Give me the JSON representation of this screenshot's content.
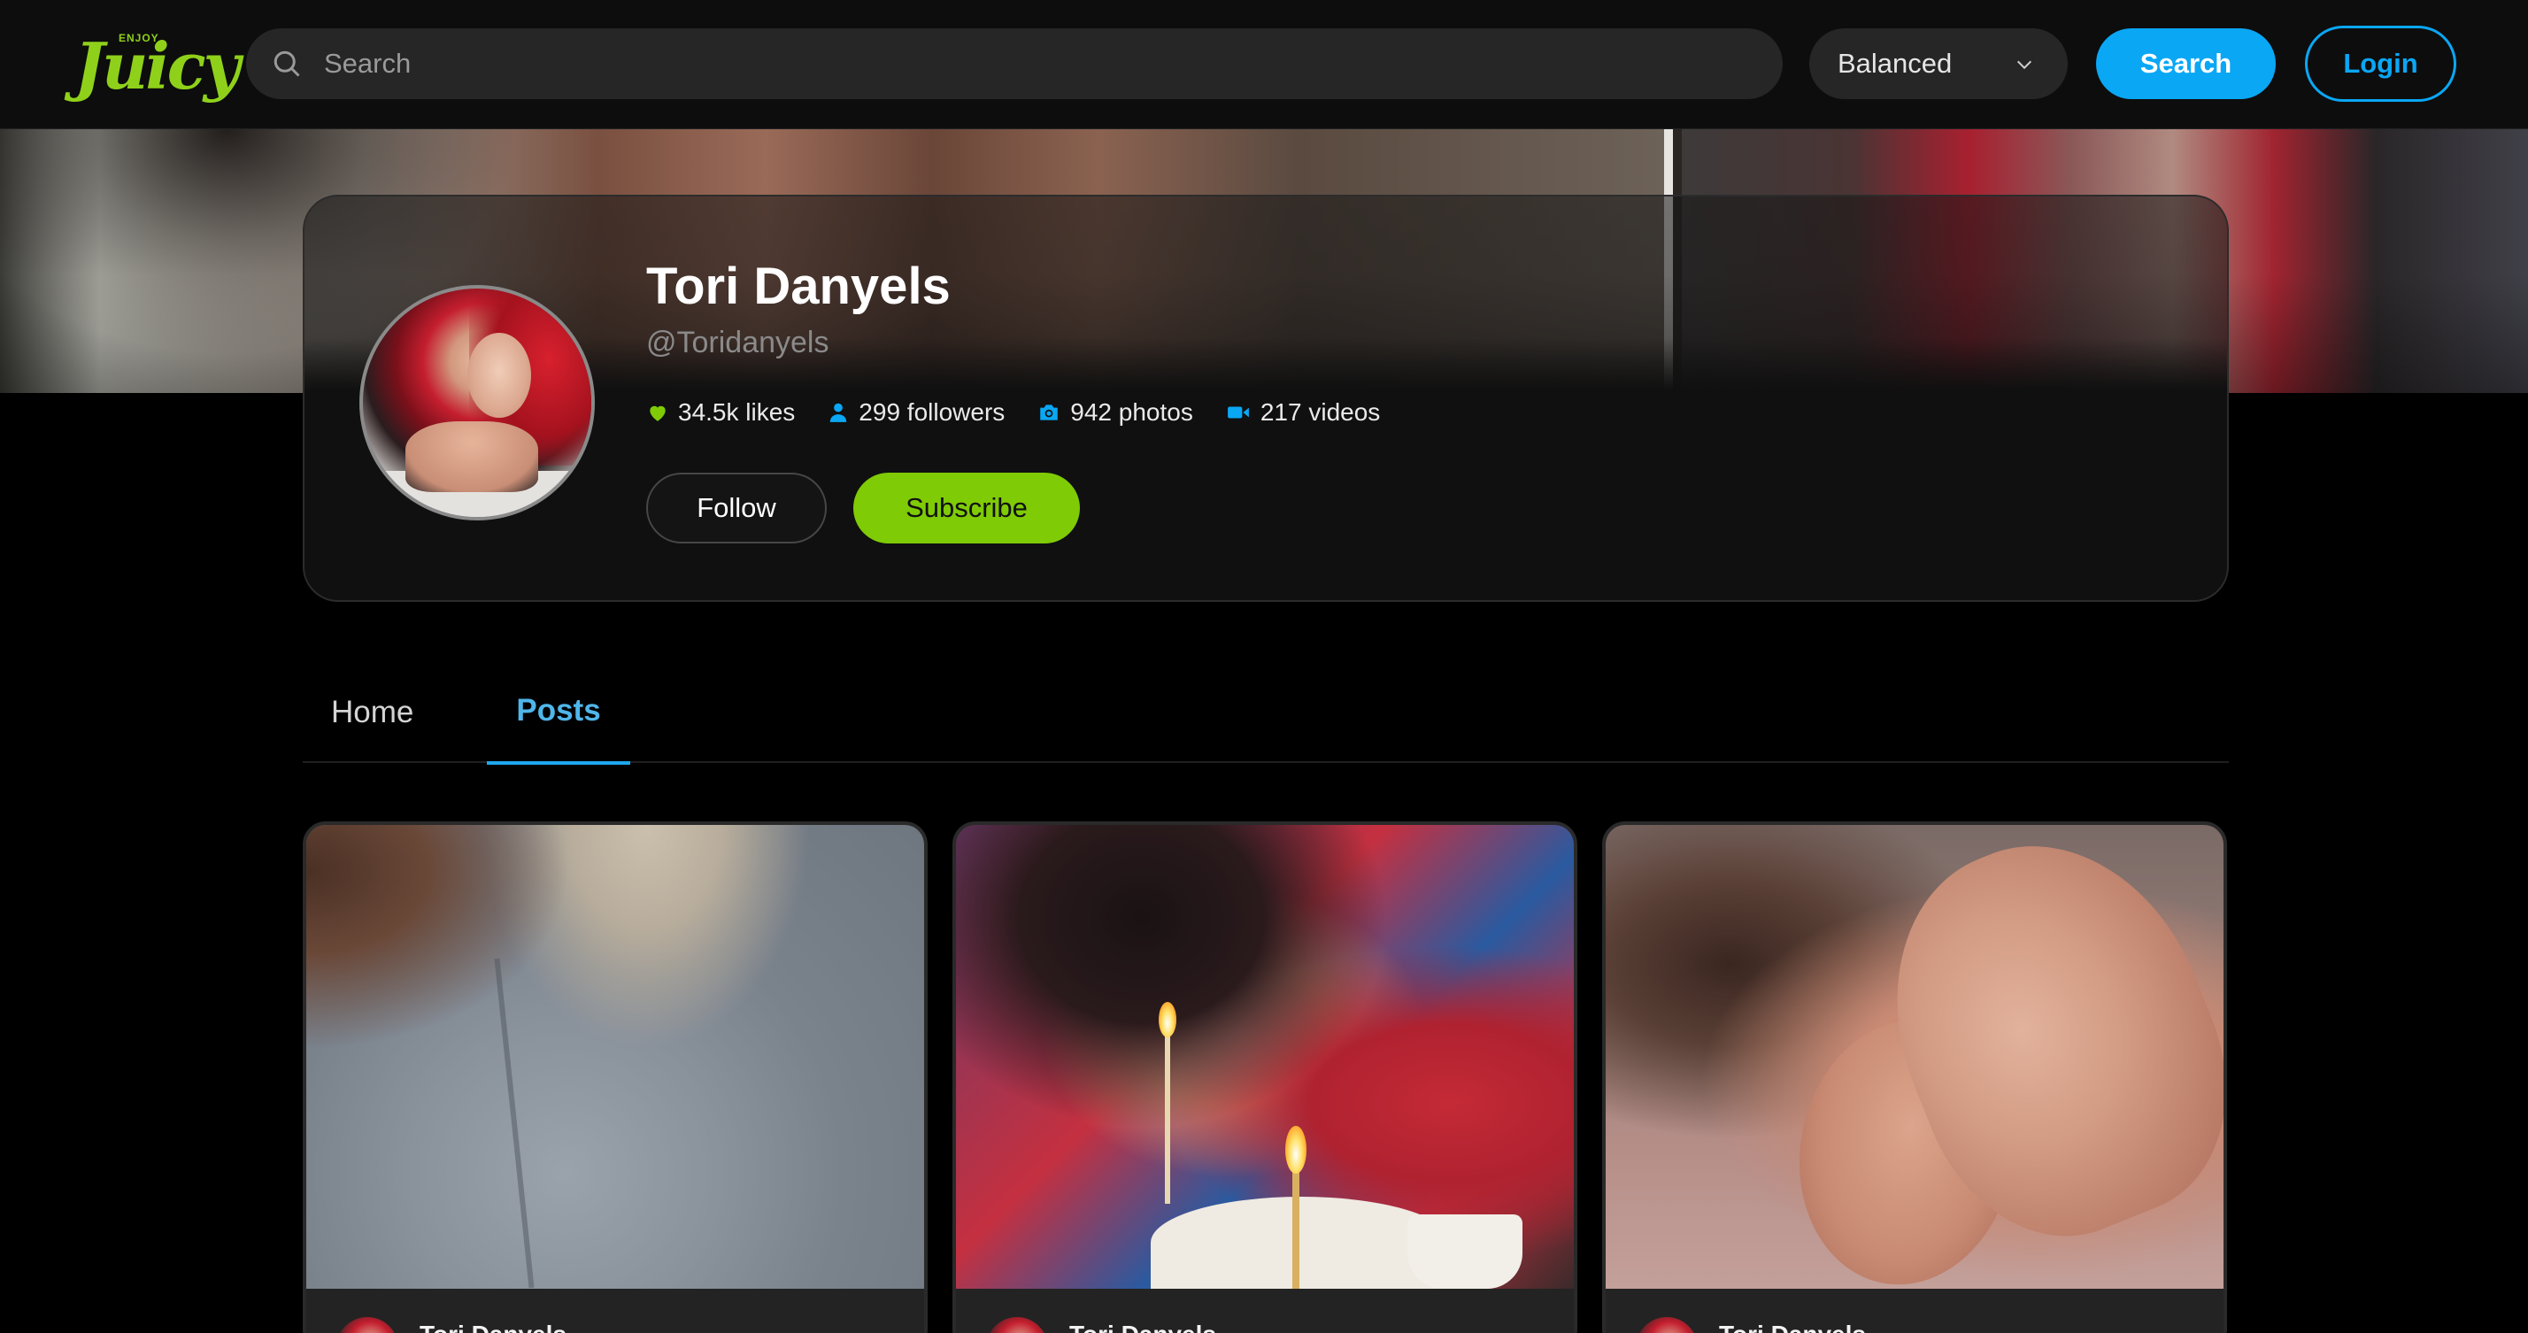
{
  "header": {
    "logo_small": "ENJOY",
    "logo_text": "Juicy",
    "search_placeholder": "Search",
    "quality_select": "Balanced",
    "search_button": "Search",
    "login_button": "Login"
  },
  "profile": {
    "name": "Tori Danyels",
    "handle": "@Toridanyels",
    "stats": {
      "likes": "34.5k likes",
      "followers": "299 followers",
      "photos": "942 photos",
      "videos": "217 videos"
    },
    "follow_button": "Follow",
    "subscribe_button": "Subscribe"
  },
  "tabs": [
    {
      "label": "Home",
      "active": false
    },
    {
      "label": "Posts",
      "active": true
    }
  ],
  "posts": [
    {
      "author": "Tori Danyels"
    },
    {
      "author": "Tori Danyels"
    },
    {
      "author": "Tori Danyels"
    }
  ],
  "colors": {
    "brand_green": "#7fcb06",
    "accent_blue": "#0aa7f5",
    "background": "#000000"
  },
  "icons": {
    "likes": "heart-icon",
    "followers": "user-icon",
    "photos": "camera-icon",
    "videos": "video-icon",
    "search": "search-icon",
    "select": "chevron-down-icon"
  }
}
